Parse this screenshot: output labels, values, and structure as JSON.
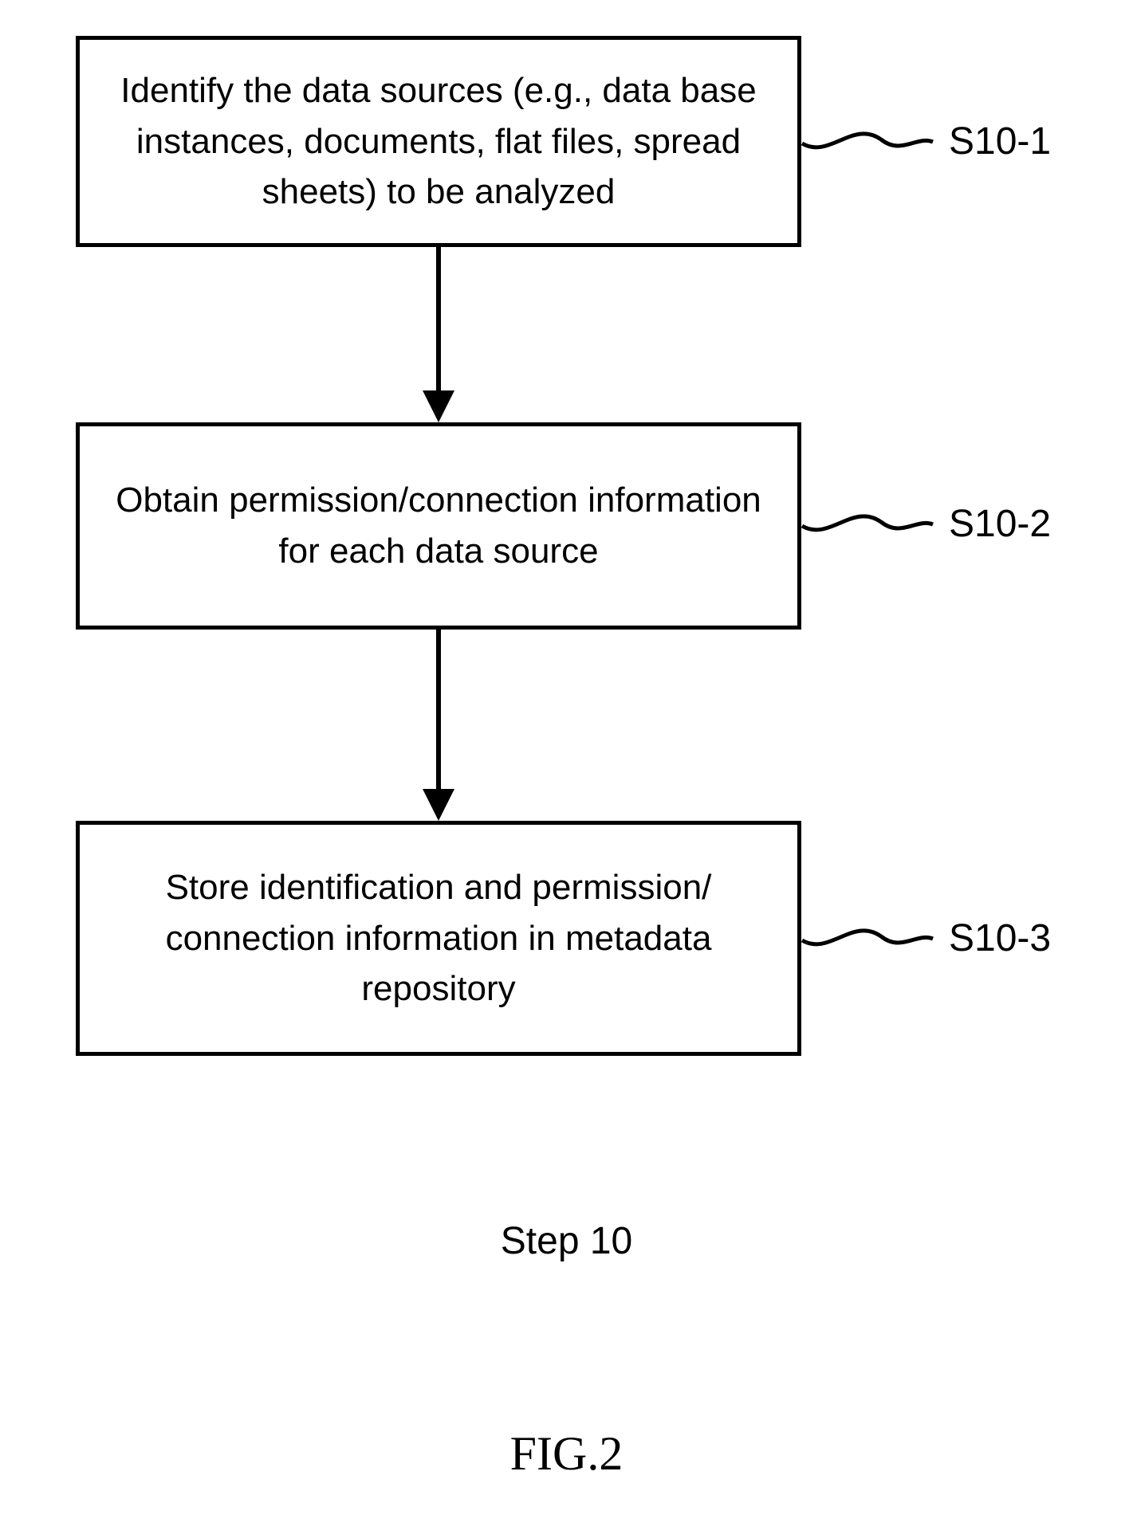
{
  "boxes": [
    {
      "text": "Identify the data sources (e.g., data base instances, documents, flat files, spread sheets) to be analyzed",
      "label": "S10-1"
    },
    {
      "text": "Obtain permission/connection information for each data source",
      "label": "S10-2"
    },
    {
      "text": "Store identification and permission/ connection information in metadata repository",
      "label": "S10-3"
    }
  ],
  "caption_step": "Step 10",
  "caption_figure": "FIG.2"
}
